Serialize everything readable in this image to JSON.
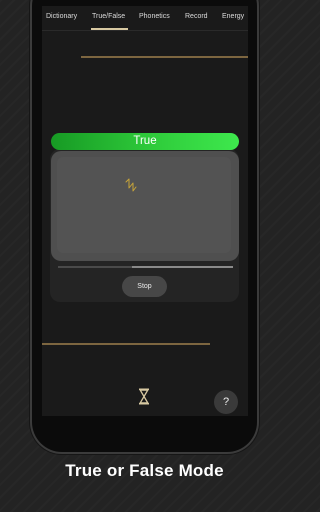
{
  "tabs": [
    {
      "label": "Dictionary",
      "active": false
    },
    {
      "label": "True/False",
      "active": true
    },
    {
      "label": "Phonetics",
      "active": false
    },
    {
      "label": "Record",
      "active": false
    },
    {
      "label": "Energy",
      "active": false
    }
  ],
  "answer": {
    "label": "True",
    "color": "#2fcc3b"
  },
  "playback": {
    "progress": 0.58
  },
  "controls": {
    "stop_label": "Stop",
    "help_label": "?"
  },
  "icons": {
    "waveform": "waveform-icon",
    "hourglass": "hourglass-icon"
  },
  "accent_color": "#7d6640",
  "caption": "True or False Mode"
}
